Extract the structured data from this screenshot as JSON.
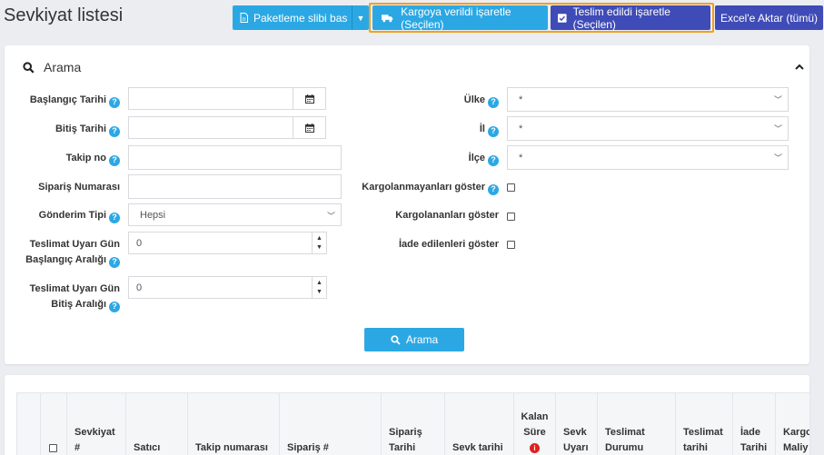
{
  "page": {
    "title": "Sevkiyat listesi"
  },
  "toolbar": {
    "packaging_label": "Paketleme slibi bas",
    "mark_shipped_label": "Kargoya verildi işaretle (Seçilen)",
    "mark_delivered_label": "Teslim edildi işaretle (Seçilen)",
    "excel_label": "Excel'e Aktar (tümü)"
  },
  "search": {
    "header": "Arama",
    "start_date_label": "Başlangıç Tarihi",
    "end_date_label": "Bitiş Tarihi",
    "tracking_label": "Takip no",
    "order_number_label": "Sipariş Numarası",
    "shipping_type_label": "Gönderim Tipi",
    "shipping_type_value": "Hepsi",
    "warn_start_label_1": "Teslimat Uyarı Gün",
    "warn_start_label_2": "Başlangıç Aralığı",
    "warn_start_value": "0",
    "warn_end_label_1": "Teslimat Uyarı Gün",
    "warn_end_label_2": "Bitiş Aralığı",
    "warn_end_value": "0",
    "country_label": "Ülke",
    "country_value": "*",
    "province_label": "İl",
    "province_value": "*",
    "district_label": "İlçe",
    "district_value": "*",
    "not_shipped_label": "Kargolanmayanları göster",
    "shipped_label": "Kargolananları göster",
    "returned_label": "İade edilenleri göster",
    "search_button_label": "Arama"
  },
  "table": {
    "headers": {
      "shipment_1": "Sevkiyat",
      "shipment_2": "#",
      "seller": "Satıcı",
      "tracking": "Takip numarası",
      "order": "Sipariş #",
      "order_date_1": "Sipariş",
      "order_date_2": "Tarihi",
      "ship_date": "Sevk tarihi",
      "remaining_1": "Kalan",
      "remaining_2": "Süre",
      "ship_warn_1": "Sevk",
      "ship_warn_2": "Uyarı",
      "delivery_status_1": "Teslimat",
      "delivery_status_2": "Durumu",
      "delivery_date_1": "Teslimat",
      "delivery_date_2": "tarihi",
      "return_date_1": "İade",
      "return_date_2": "Tarihi",
      "cargo_cost_1": "Kargo",
      "cargo_cost_2": "Maliy"
    }
  },
  "colors": {
    "accent": "#2ba8e4",
    "primary_dark": "#3f4bb7",
    "highlight": "#f3a01f",
    "danger": "#e02020"
  }
}
